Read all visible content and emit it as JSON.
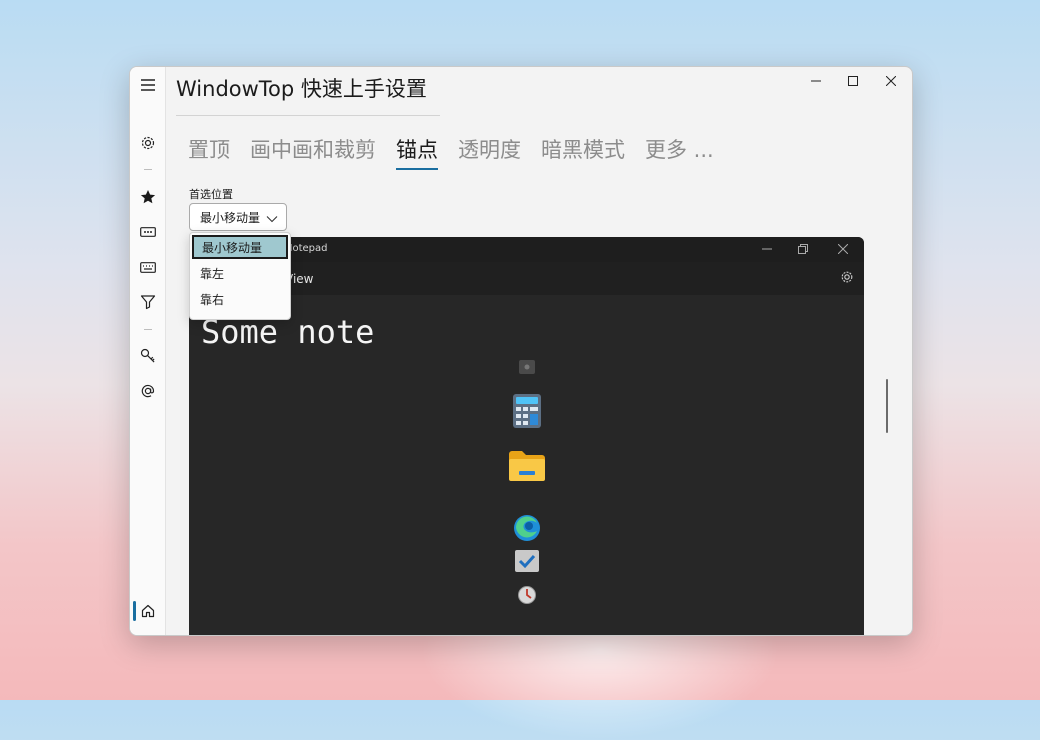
{
  "window": {
    "title": "WindowTop 快速上手设置"
  },
  "caption_buttons": {
    "minimize": "—",
    "maximize": "☐",
    "close": "✕"
  },
  "sidebar": {
    "icons": [
      "hamburger-menu-icon",
      "gear-icon",
      "star-icon",
      "ellipsis-box-icon",
      "keyboard-icon",
      "filter-icon",
      "key-icon",
      "at-sign-icon",
      "home-icon"
    ],
    "active": "home"
  },
  "tabs": [
    {
      "label": "置顶",
      "selected": false
    },
    {
      "label": "画中画和裁剪",
      "selected": false
    },
    {
      "label": "锚点",
      "selected": true
    },
    {
      "label": "透明度",
      "selected": false
    },
    {
      "label": "暗黑模式",
      "selected": false
    },
    {
      "label": "更多 ...",
      "selected": false
    }
  ],
  "anchor": {
    "label": "首选位置",
    "selected_value": "最小移动量",
    "options": [
      "最小移动量",
      "靠左",
      "靠右"
    ]
  },
  "preview": {
    "window_title": "Notepad",
    "menu_view": "View",
    "note_text": "Some note",
    "dock_icons": [
      "small-app-icon",
      "calculator-icon",
      "file-explorer-icon",
      "edge-icon",
      "todo-icon",
      "clock-icon"
    ]
  },
  "colors": {
    "accent": "#1a6ea0",
    "selected_option_bg": "#9fc8cf",
    "preview_bg": "#272727"
  }
}
